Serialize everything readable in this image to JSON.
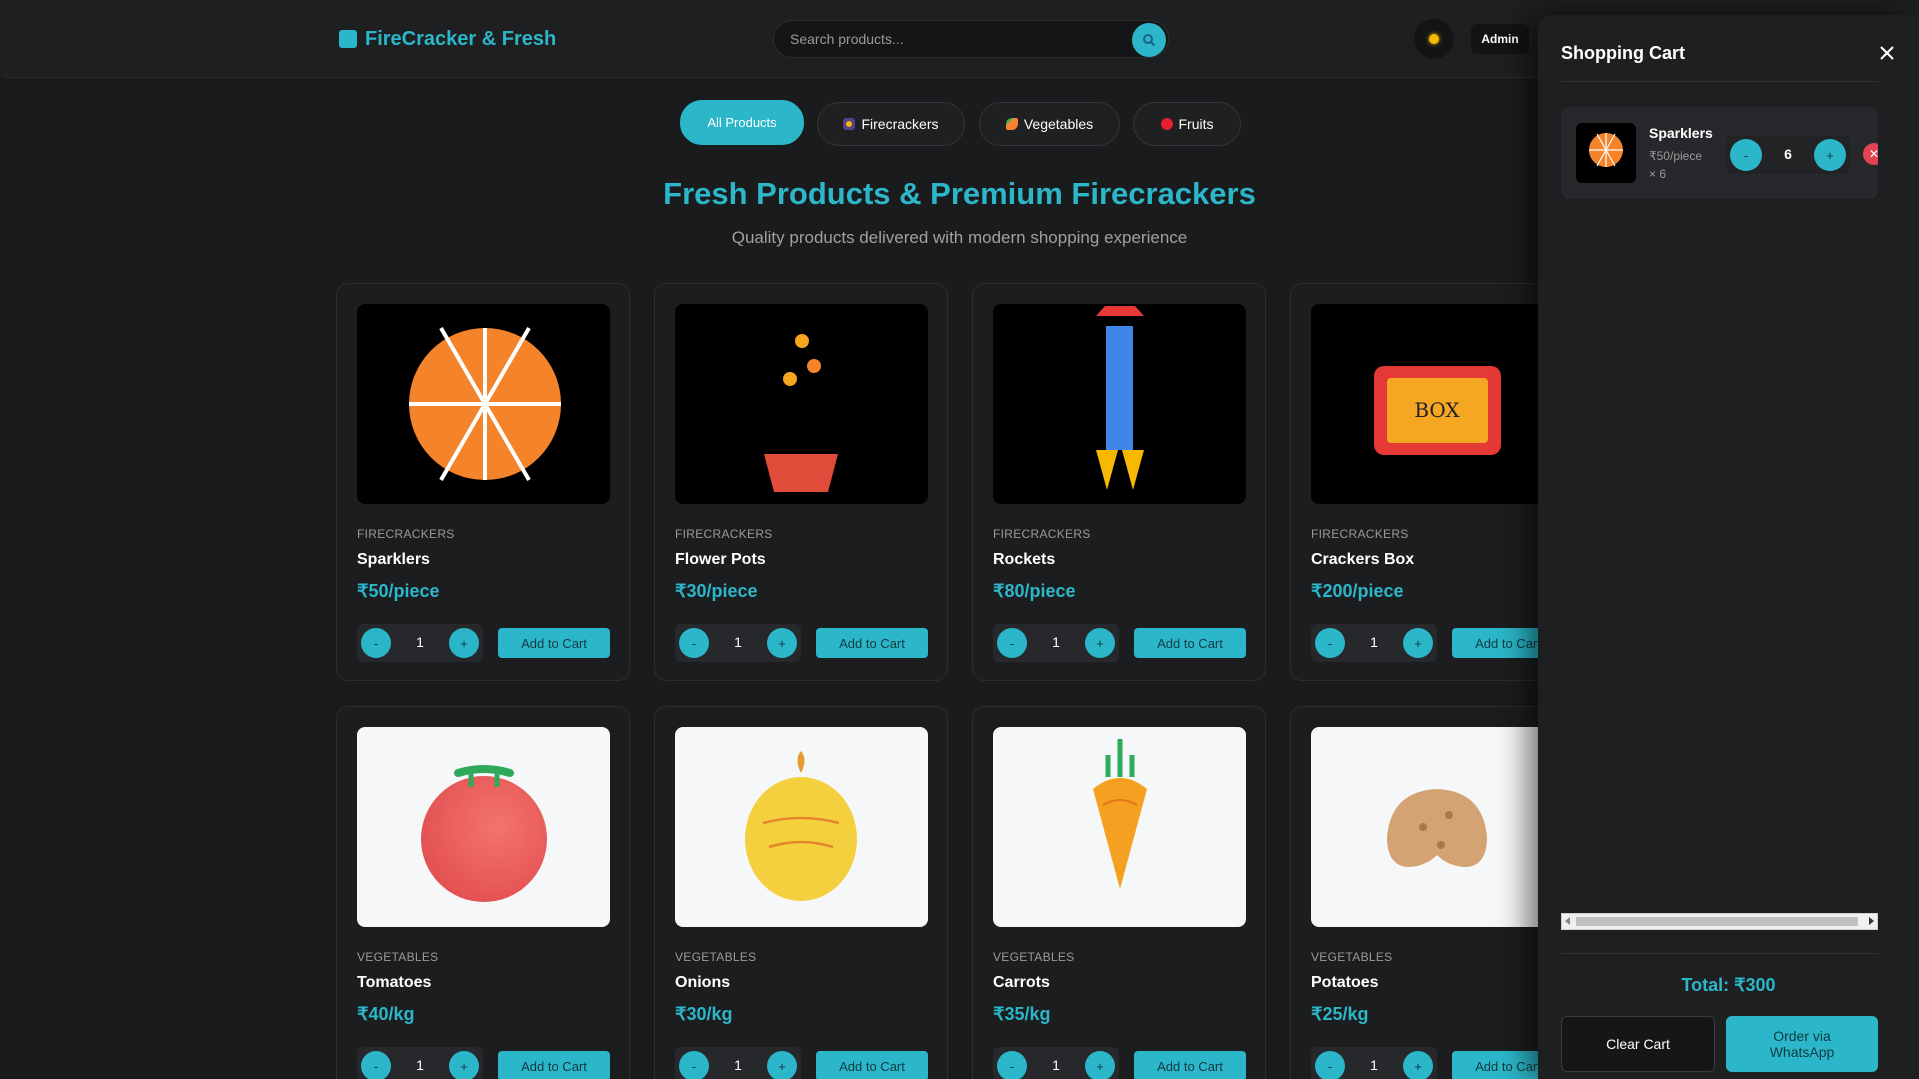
{
  "header": {
    "brand": "FireCracker & Fresh",
    "search_placeholder": "Search products...",
    "admin_label": "Admin"
  },
  "tabs": [
    {
      "label": "All Products",
      "icon": ""
    },
    {
      "label": "Firecrackers",
      "icon": "firework-icon"
    },
    {
      "label": "Vegetables",
      "icon": "carrot-icon"
    },
    {
      "label": "Fruits",
      "icon": "apple-icon"
    }
  ],
  "hero": {
    "title": "Fresh Products & Premium Firecrackers",
    "subtitle": "Quality products delivered with modern shopping experience"
  },
  "products": [
    {
      "category": "FIRECRACKERS",
      "name": "Sparklers",
      "price": "₹50/piece",
      "qty": "1",
      "image": "sparkler-image"
    },
    {
      "category": "FIRECRACKERS",
      "name": "Flower Pots",
      "price": "₹30/piece",
      "qty": "1",
      "image": "flower-pot-image"
    },
    {
      "category": "FIRECRACKERS",
      "name": "Rockets",
      "price": "₹80/piece",
      "qty": "1",
      "image": "rocket-image"
    },
    {
      "category": "FIRECRACKERS",
      "name": "Crackers Box",
      "price": "₹200/piece",
      "qty": "1",
      "image": "crackers-box-image",
      "image_text": "BOX"
    },
    {
      "category": "VEGETABLES",
      "name": "Tomatoes",
      "price": "₹40/kg",
      "qty": "1",
      "image": "tomato-image"
    },
    {
      "category": "VEGETABLES",
      "name": "Onions",
      "price": "₹30/kg",
      "qty": "1",
      "image": "onion-image"
    },
    {
      "category": "VEGETABLES",
      "name": "Carrots",
      "price": "₹35/kg",
      "qty": "1",
      "image": "carrot-image"
    },
    {
      "category": "VEGETABLES",
      "name": "Potatoes",
      "price": "₹25/kg",
      "qty": "1",
      "image": "potato-image"
    }
  ],
  "buttons": {
    "minus": "-",
    "plus": "+",
    "add_to_cart": "Add to Cart"
  },
  "cart": {
    "title": "Shopping Cart",
    "items": [
      {
        "name": "Sparklers",
        "unit_price": "₹50/piece",
        "times": "× 6",
        "qty": "6",
        "remove": "✕"
      }
    ],
    "total": "Total: ₹300",
    "clear_label": "Clear Cart",
    "order_label": "Order via WhatsApp"
  },
  "colors": {
    "accent": "#2bb7c9",
    "background": "#1a1b1d",
    "danger": "#e04452"
  }
}
